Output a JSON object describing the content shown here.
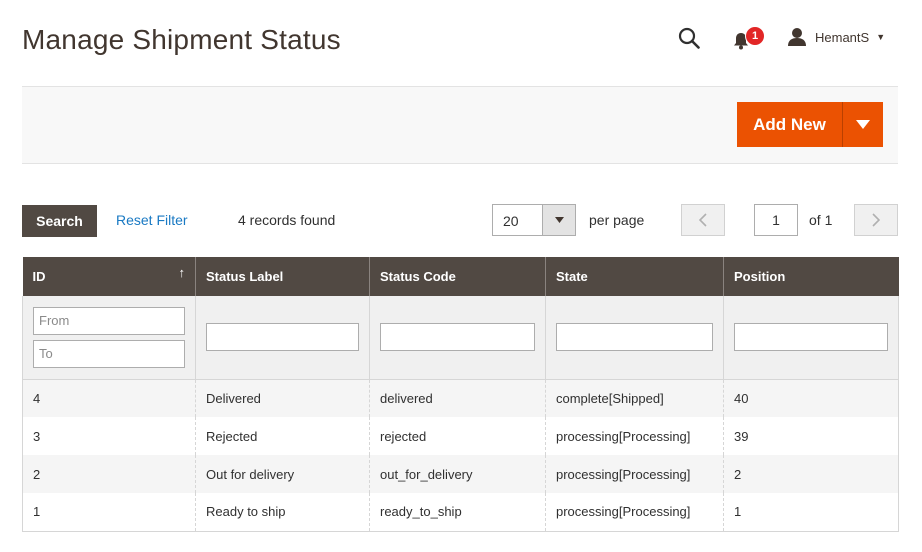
{
  "page": {
    "title": "Manage Shipment Status"
  },
  "header": {
    "notifications_count": "1",
    "user_name": "HemantS"
  },
  "actions": {
    "add_new_label": "Add New"
  },
  "toolbar": {
    "search_label": "Search",
    "reset_filter_label": "Reset Filter",
    "records_found": "4 records found",
    "per_page_value": "20",
    "per_page_label": "per page",
    "current_page": "1",
    "of_pages": "of 1"
  },
  "grid": {
    "columns": [
      "ID",
      "Status Label",
      "Status Code",
      "State",
      "Position"
    ],
    "filters": {
      "id_from_placeholder": "From",
      "id_to_placeholder": "To"
    },
    "rows": [
      {
        "id": "4",
        "label": "Delivered",
        "code": "delivered",
        "state": "complete[Shipped]",
        "position": "40"
      },
      {
        "id": "3",
        "label": "Rejected",
        "code": "rejected",
        "state": "processing[Processing]",
        "position": "39"
      },
      {
        "id": "2",
        "label": "Out for delivery",
        "code": "out_for_delivery",
        "state": "processing[Processing]",
        "position": "2"
      },
      {
        "id": "1",
        "label": "Ready to ship",
        "code": "ready_to_ship",
        "state": "processing[Processing]",
        "position": "1"
      }
    ]
  },
  "colors": {
    "accent": "#eb5202",
    "header_bg": "#514943",
    "link": "#1979c3",
    "badge": "#e22626"
  }
}
